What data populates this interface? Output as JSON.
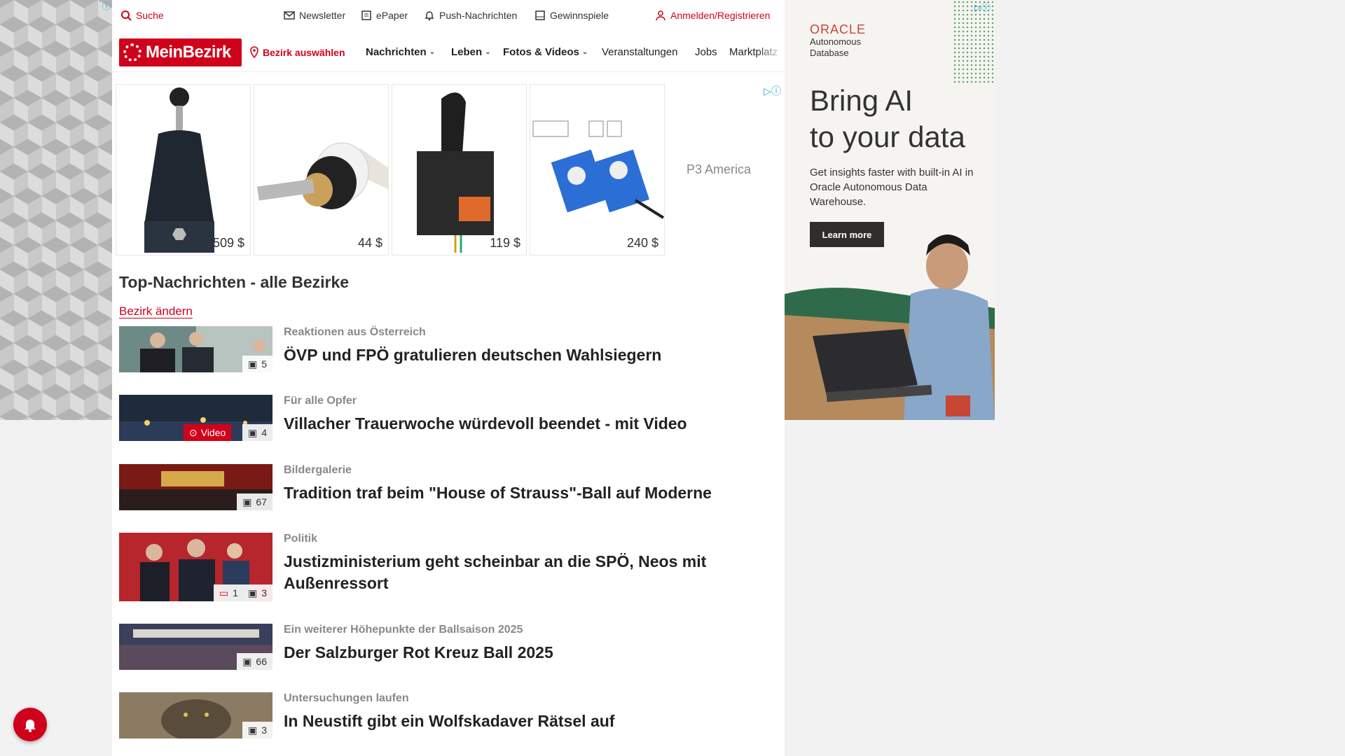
{
  "utility_bar": {
    "search": "Suche",
    "newsletter": "Newsletter",
    "epaper": "ePaper",
    "push": "Push-Nachrichten",
    "games": "Gewinnspiele",
    "login": "Anmelden/Registrieren"
  },
  "nav": {
    "logo": "MeinBezirk",
    "district": "Bezirk auswählen",
    "items": [
      "Nachrichten",
      "Leben",
      "Fotos & Videos",
      "Veranstaltungen",
      "Jobs",
      "Marktplatz"
    ]
  },
  "ad_strip": {
    "products": [
      {
        "price": "509 $"
      },
      {
        "price": "44 $"
      },
      {
        "price": "119 $"
      },
      {
        "price": "240 $"
      }
    ],
    "advertiser": "P3 America"
  },
  "section": {
    "title": "Top-Nachrichten - alle Bezirke",
    "change_district": "Bezirk ändern"
  },
  "articles": [
    {
      "kicker": "Reaktionen aus Österreich",
      "headline": "ÖVP und FPÖ gratulieren deutschen Wahlsiegern",
      "images": "5",
      "video": "",
      "comments": ""
    },
    {
      "kicker": "Für alle Opfer",
      "headline": "Villacher Trauerwoche würdevoll beendet - mit Video",
      "images": "4",
      "video": "Video",
      "comments": ""
    },
    {
      "kicker": "Bildergalerie",
      "headline": "Tradition traf beim \"House of Strauss\"-Ball auf Moderne",
      "images": "67",
      "video": "",
      "comments": ""
    },
    {
      "kicker": "Politik",
      "headline": "Justizministerium geht scheinbar an die SPÖ, Neos mit Außenressort",
      "images": "3",
      "video": "",
      "comments": "1"
    },
    {
      "kicker": "Ein weiterer Höhepunkte der Ballsaison 2025",
      "headline": "Der Salzburger Rot Kreuz Ball 2025",
      "images": "66",
      "video": "",
      "comments": ""
    },
    {
      "kicker": "Untersuchungen laufen",
      "headline": "In Neustift gibt ein Wolfskadaver Rätsel auf",
      "images": "3",
      "video": "",
      "comments": ""
    }
  ],
  "oracle_ad": {
    "brand": "ORACLE",
    "product": "Autonomous Database",
    "headline_line1": "Bring AI",
    "headline_line2": "to your data",
    "body": "Get insights faster with built-in AI in Oracle Autonomous Data Warehouse.",
    "cta": "Learn more"
  },
  "colors": {
    "brand_red": "#d0021b",
    "oracle_red": "#c74634"
  }
}
